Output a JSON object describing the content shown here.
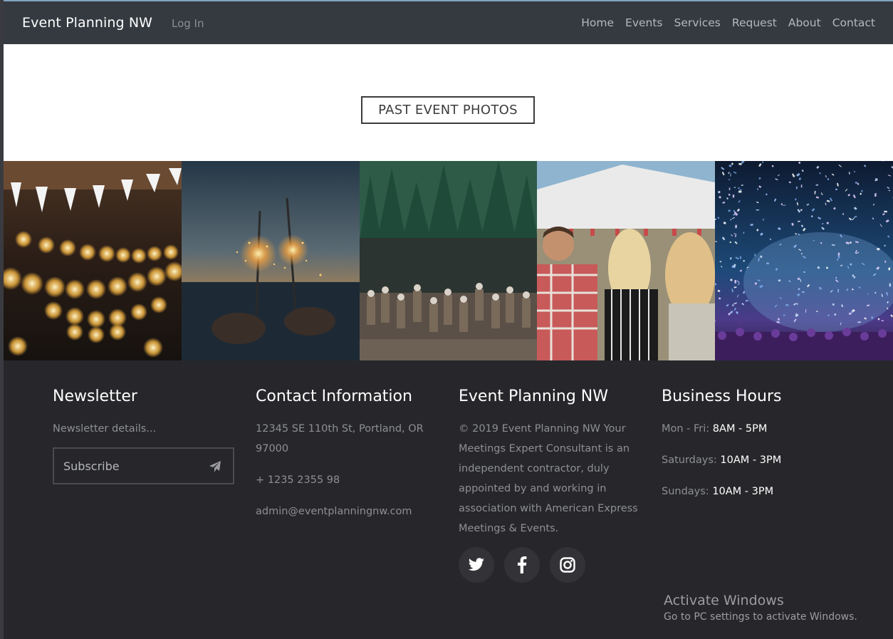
{
  "navbar": {
    "brand": "Event Planning NW",
    "login": "Log In",
    "links": [
      "Home",
      "Events",
      "Services",
      "Request",
      "About",
      "Contact"
    ]
  },
  "hero": {
    "title": "PAST EVENT PHOTOS"
  },
  "gallery": {
    "photos": [
      "string-lights-photo",
      "sparklers-photo",
      "lake-party-photo",
      "festival-crowd-photo",
      "confetti-concert-photo"
    ]
  },
  "footer": {
    "newsletter": {
      "heading": "Newsletter",
      "details": "Newsletter details...",
      "subscribe_placeholder": "Subscribe"
    },
    "contact": {
      "heading": "Contact Information",
      "address": "12345 SE 110th St, Portland, OR 97000",
      "phone": "+ 1235 2355 98",
      "email": "admin@eventplanningnw.com"
    },
    "about": {
      "heading": "Event Planning NW",
      "text": "© 2019 Event Planning NW Your Meetings Expert Consultant is an independent contractor, duly appointed by and working in association with American Express Meetings & Events."
    },
    "social": [
      "twitter-icon",
      "facebook-icon",
      "instagram-icon"
    ],
    "hours": {
      "heading": "Business Hours",
      "rows": [
        {
          "label": "Mon - Fri:",
          "value": "8AM - 5PM"
        },
        {
          "label": "Saturdays:",
          "value": "10AM - 3PM"
        },
        {
          "label": "Sundays:",
          "value": "10AM - 3PM"
        }
      ]
    }
  },
  "watermark": {
    "title": "Activate Windows",
    "subtitle": "Go to PC settings to activate Windows."
  }
}
